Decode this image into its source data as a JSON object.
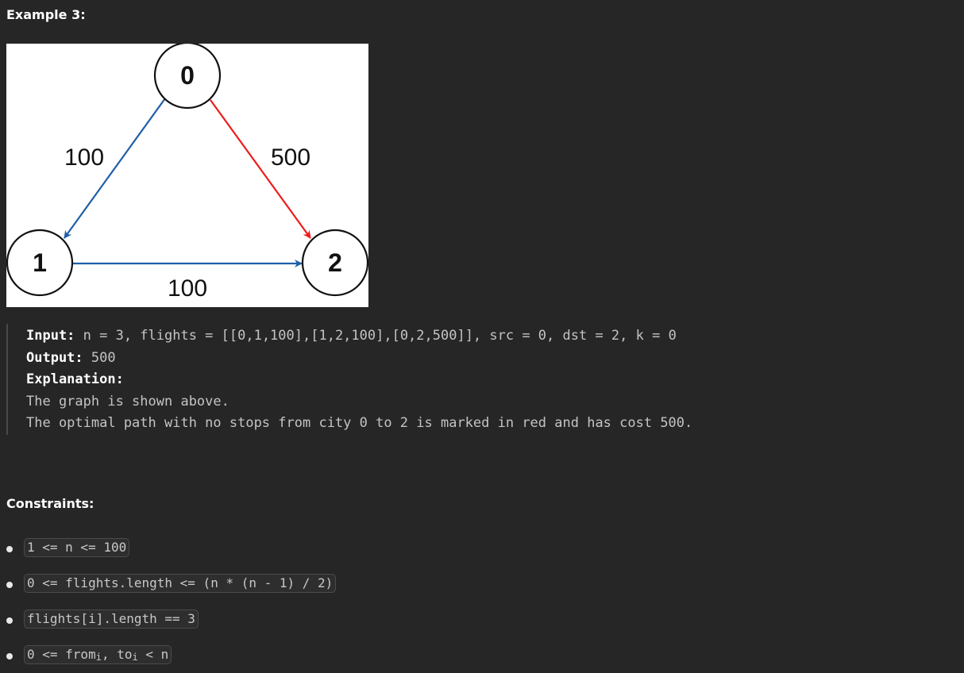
{
  "example": {
    "heading": "Example 3:",
    "graph": {
      "nodes": [
        "0",
        "1",
        "2"
      ],
      "edges": [
        {
          "from": "0",
          "to": "1",
          "weight": "100",
          "color": "#1f5fa8"
        },
        {
          "from": "1",
          "to": "2",
          "weight": "100",
          "color": "#1f5fa8"
        },
        {
          "from": "0",
          "to": "2",
          "weight": "500",
          "color": "#ee1c1c"
        }
      ]
    },
    "input_label": "Input:",
    "input_value": " n = 3, flights = [[0,1,100],[1,2,100],[0,2,500]], src = 0, dst = 2, k = 0",
    "output_label": "Output:",
    "output_value": " 500",
    "explanation_label": "Explanation:",
    "explanation_lines": [
      "The graph is shown above.",
      "The optimal path with no stops from city 0 to 2 is marked in red and has cost 500."
    ]
  },
  "constraints": {
    "heading": "Constraints:",
    "items": [
      {
        "text": "1 <= n <= 100"
      },
      {
        "text": "0 <= flights.length <= (n * (n - 1) / 2)"
      },
      {
        "text": "flights[i].length == 3"
      },
      {
        "pre": "0 <= from",
        "sub1": "i",
        "mid": ", to",
        "sub2": "i",
        "post": " < n"
      }
    ]
  },
  "colors": {
    "background": "#262626",
    "blue_edge": "#1f5fa8",
    "red_edge": "#ee1c1c"
  }
}
